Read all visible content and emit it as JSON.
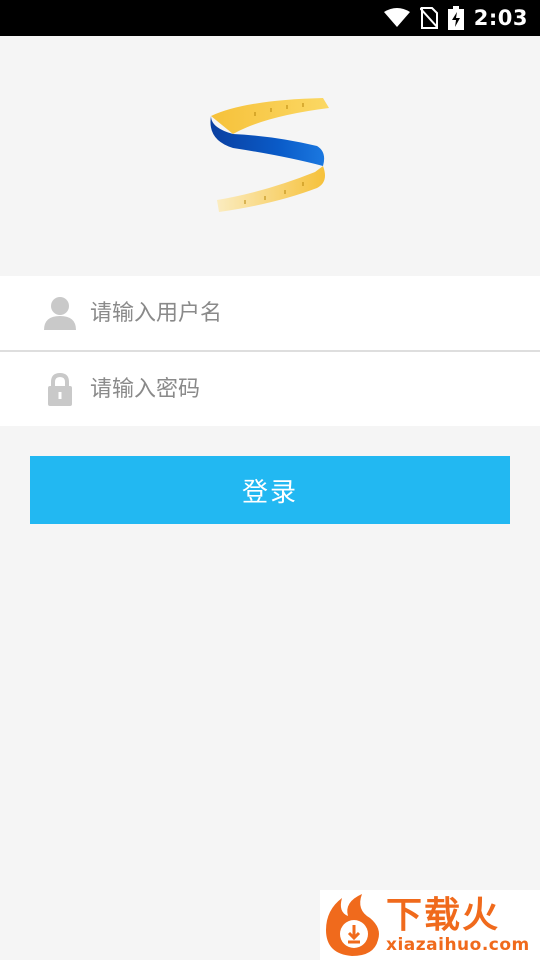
{
  "status_bar": {
    "time": "2:03",
    "icons": [
      "wifi-icon",
      "no-sim-icon",
      "battery-charging-icon"
    ]
  },
  "logo": {
    "icon": "measuring-tape-logo"
  },
  "form": {
    "username": {
      "placeholder": "请输入用户名",
      "value": "",
      "icon": "user-icon"
    },
    "password": {
      "placeholder": "请输入密码",
      "value": "",
      "icon": "lock-icon"
    },
    "login_label": "登录"
  },
  "watermark": {
    "title": "下载火",
    "url": "xiazaihuo.com",
    "icon": "flame-download-icon"
  },
  "colors": {
    "background": "#f5f5f5",
    "button": "#22b8f2",
    "watermark": "#f06a1c"
  }
}
